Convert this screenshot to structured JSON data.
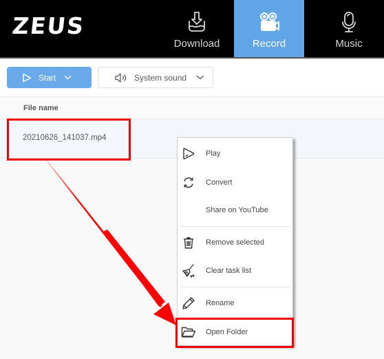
{
  "app": {
    "logo": "ZEUS"
  },
  "nav": {
    "tabs": [
      {
        "label": "Download",
        "icon": "download-icon",
        "active": false
      },
      {
        "label": "Record",
        "icon": "video-camera-icon",
        "active": true
      },
      {
        "label": "Music",
        "icon": "microphone-icon",
        "active": false
      }
    ]
  },
  "toolbar": {
    "start_label": "Start",
    "sound_label": "System sound"
  },
  "table": {
    "columns": [
      "File name"
    ],
    "rows": [
      {
        "file_name": "20210626_141037.mp4"
      }
    ]
  },
  "context_menu": {
    "items": [
      {
        "label": "Play",
        "icon": "play-icon"
      },
      {
        "label": "Convert",
        "icon": "convert-icon"
      },
      {
        "label": "Share on YouTube",
        "icon": ""
      },
      {
        "label": "Remove selected",
        "icon": "trash-icon"
      },
      {
        "label": "Clear task list",
        "icon": "broom-icon"
      },
      {
        "label": "Rename",
        "icon": "pencil-icon"
      },
      {
        "label": "Open Folder",
        "icon": "folder-open-icon"
      }
    ]
  },
  "colors": {
    "accent": "#5fa5e8",
    "annotation": "#ee0000",
    "header_bg": "#000000"
  }
}
